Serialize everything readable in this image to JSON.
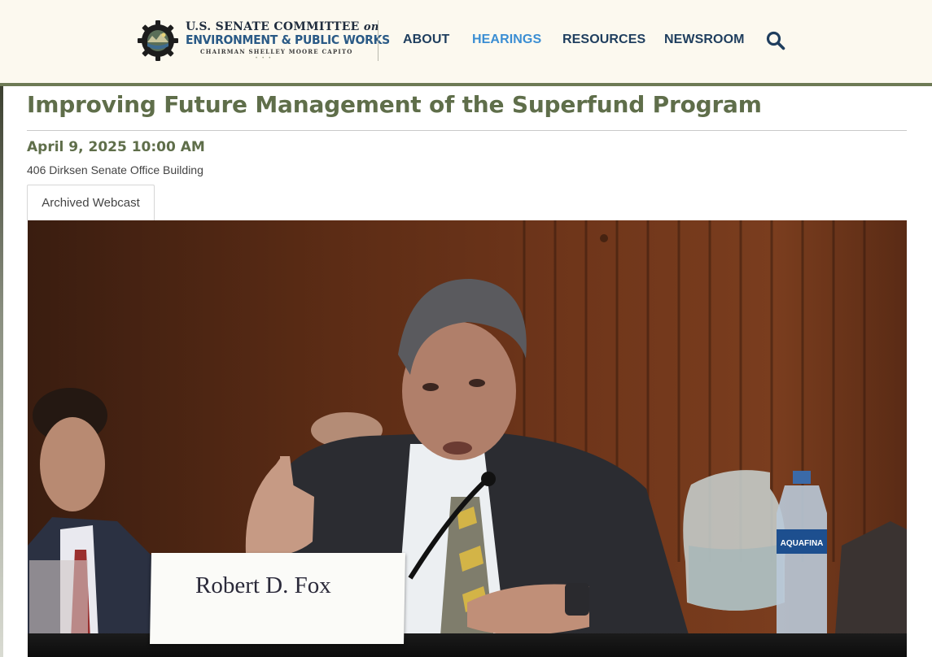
{
  "header": {
    "logo": {
      "line1": "U.S. SENATE COMMITTEE",
      "line1_suffix": "on",
      "line2": "ENVIRONMENT & PUBLIC WORKS",
      "line3": "CHAIRMAN SHELLEY MOORE CAPITO"
    },
    "nav": [
      {
        "label": "ABOUT",
        "active": false
      },
      {
        "label": "HEARINGS",
        "active": true
      },
      {
        "label": "RESOURCES",
        "active": false
      },
      {
        "label": "NEWSROOM",
        "active": false
      }
    ],
    "search_icon": "search-icon"
  },
  "hearing": {
    "title": "Improving Future Management of the Superfund Program",
    "datetime": "April 9, 2025 10:00 AM",
    "location": "406 Dirksen Senate Office Building",
    "tab_label": "Archived Webcast"
  },
  "video": {
    "nameplate": "Robert D. Fox",
    "bottle_label": "AQUAFINA"
  },
  "colors": {
    "header_bg": "#fcf9ef",
    "accent_olive": "#5f6e4a",
    "nav_text": "#1f3e5e",
    "nav_active": "#3b8ed3"
  }
}
